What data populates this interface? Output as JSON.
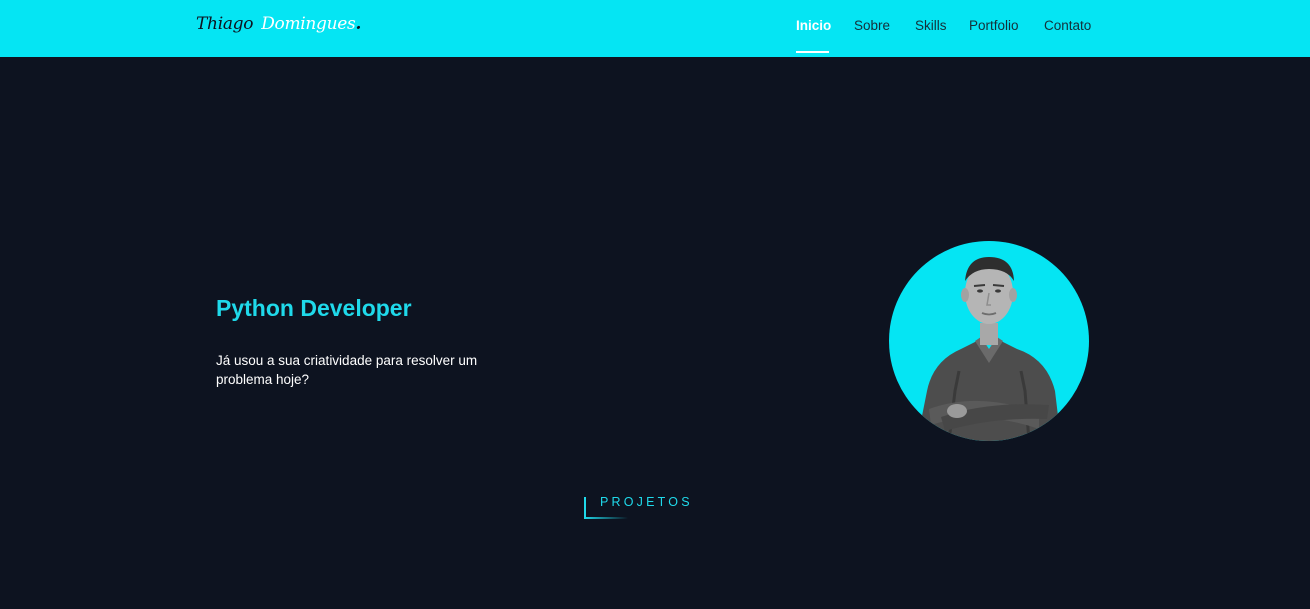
{
  "brand": {
    "first": "Thiago",
    "last": "Domingues",
    "dot": "."
  },
  "nav": {
    "items": [
      {
        "label": "Inicio",
        "active": true
      },
      {
        "label": "Sobre",
        "active": false
      },
      {
        "label": "Skills",
        "active": false
      },
      {
        "label": "Portfolio",
        "active": false
      },
      {
        "label": "Contato",
        "active": false
      }
    ]
  },
  "hero": {
    "title": "Python Developer",
    "text": "Já usou a sua criatividade para resolver um problema hoje?"
  },
  "projects": {
    "label": "PROJETOS"
  },
  "colors": {
    "navbar": "#05e5f3",
    "background": "#0d1320",
    "accent": "#1fd9ea",
    "text": "#ffffff"
  }
}
